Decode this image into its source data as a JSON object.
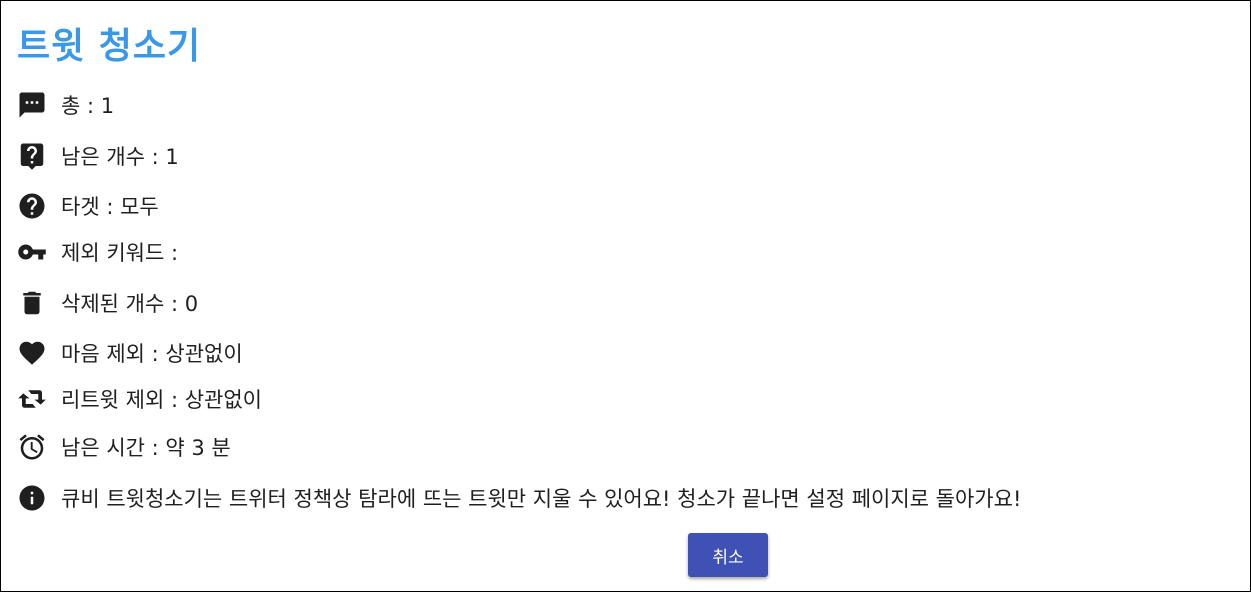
{
  "app": {
    "title": "트윗 청소기"
  },
  "stats": [
    {
      "icon": "comment-dots-icon",
      "text": "총 : 1"
    },
    {
      "icon": "question-bubble-icon",
      "text": "남은 개수 : 1"
    },
    {
      "icon": "help-circle-icon",
      "text": "타겟 : 모두"
    },
    {
      "icon": "key-icon",
      "text": "제외 키워드 :"
    },
    {
      "icon": "trash-icon",
      "text": "삭제된 개수 : 0"
    },
    {
      "icon": "heart-icon",
      "text": "마음 제외 : 상관없이"
    },
    {
      "icon": "retweet-icon",
      "text": "리트윗 제외 : 상관없이"
    },
    {
      "icon": "alarm-clock-icon",
      "text": "남은 시간 : 약 3 분"
    },
    {
      "icon": "info-icon",
      "text": "큐비 트윗청소기는 트위터 정책상 탐라에 뜨는 트윗만 지울 수 있어요! 청소가 끝나면 설정 페이지로 돌아가요!"
    }
  ],
  "actions": {
    "cancel_label": "취소"
  },
  "colors": {
    "title": "#3b98e8",
    "button": "#3f51b5",
    "icon": "#1f1f1f"
  }
}
